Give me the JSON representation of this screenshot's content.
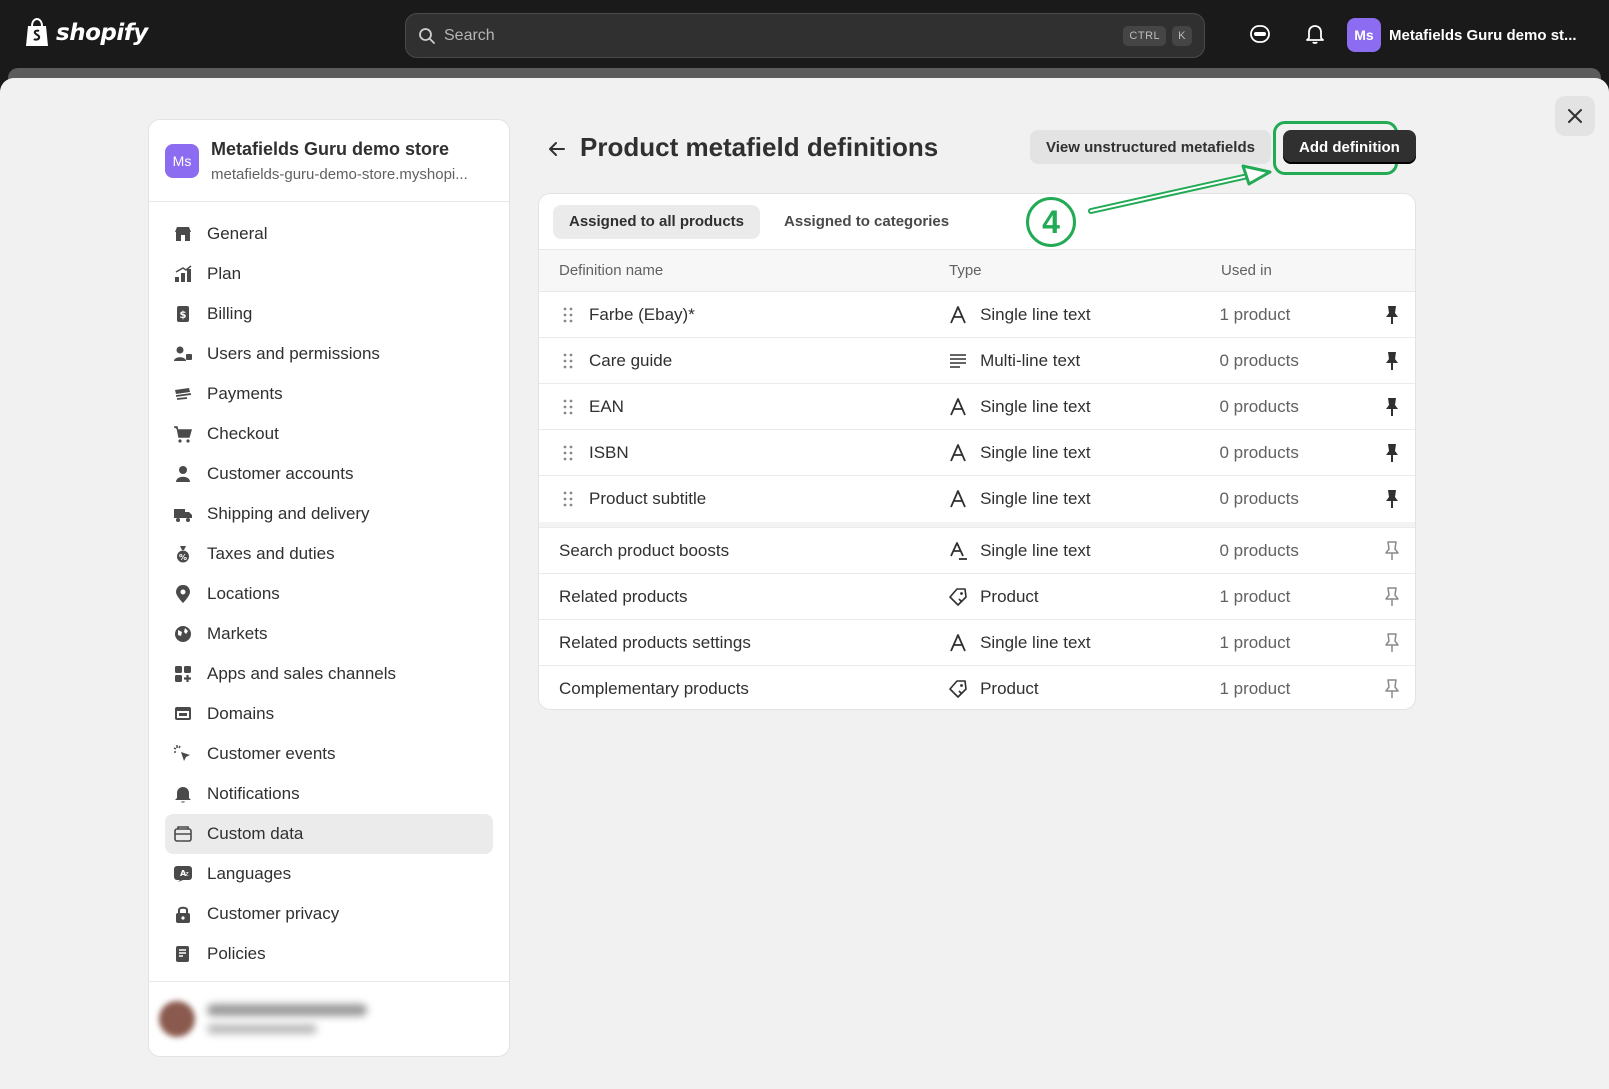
{
  "topbar": {
    "logo_text": "shopify",
    "search_placeholder": "Search",
    "shortcut_keys": [
      "CTRL",
      "K"
    ],
    "store_initials": "Ms",
    "store_name": "Metafields Guru demo st..."
  },
  "sidebar": {
    "store_initials": "Ms",
    "store_name": "Metafields Guru demo store",
    "store_domain": "metafields-guru-demo-store.myshopi...",
    "items": [
      {
        "label": "General",
        "icon": "store-icon"
      },
      {
        "label": "Plan",
        "icon": "plan-icon"
      },
      {
        "label": "Billing",
        "icon": "billing-icon"
      },
      {
        "label": "Users and permissions",
        "icon": "users-icon"
      },
      {
        "label": "Payments",
        "icon": "payments-icon"
      },
      {
        "label": "Checkout",
        "icon": "cart-icon"
      },
      {
        "label": "Customer accounts",
        "icon": "person-icon"
      },
      {
        "label": "Shipping and delivery",
        "icon": "truck-icon"
      },
      {
        "label": "Taxes and duties",
        "icon": "taxes-icon"
      },
      {
        "label": "Locations",
        "icon": "location-icon"
      },
      {
        "label": "Markets",
        "icon": "globe-icon"
      },
      {
        "label": "Apps and sales channels",
        "icon": "apps-icon"
      },
      {
        "label": "Domains",
        "icon": "domains-icon"
      },
      {
        "label": "Customer events",
        "icon": "cursor-icon"
      },
      {
        "label": "Notifications",
        "icon": "bell-icon"
      },
      {
        "label": "Custom data",
        "icon": "custom-data-icon",
        "active": true
      },
      {
        "label": "Languages",
        "icon": "languages-icon"
      },
      {
        "label": "Customer privacy",
        "icon": "lock-icon"
      },
      {
        "label": "Policies",
        "icon": "policies-icon"
      }
    ]
  },
  "main": {
    "title": "Product metafield definitions",
    "view_unstructured_label": "View unstructured metafields",
    "add_definition_label": "Add definition",
    "step_number": "4",
    "tabs": [
      {
        "label": "Assigned to all products",
        "active": true
      },
      {
        "label": "Assigned to categories",
        "active": false
      }
    ],
    "columns": {
      "name": "Definition name",
      "type": "Type",
      "used_in": "Used in"
    },
    "pinned_rows": [
      {
        "name": "Farbe (Ebay)*",
        "type": "Single line text",
        "type_icon": "text-icon",
        "used_in": "1 product"
      },
      {
        "name": "Care guide",
        "type": "Multi-line text",
        "type_icon": "multiline-icon",
        "used_in": "0 products"
      },
      {
        "name": "EAN",
        "type": "Single line text",
        "type_icon": "text-icon",
        "used_in": "0 products"
      },
      {
        "name": "ISBN",
        "type": "Single line text",
        "type_icon": "text-icon",
        "used_in": "0 products"
      },
      {
        "name": "Product subtitle",
        "type": "Single line text",
        "type_icon": "text-icon",
        "used_in": "0 products"
      }
    ],
    "unpinned_rows": [
      {
        "name": "Search product boosts",
        "type": "Single line text",
        "type_icon": "text-list-icon",
        "used_in": "0 products"
      },
      {
        "name": "Related products",
        "type": "Product",
        "type_icon": "product-tag-icon",
        "used_in": "1 product"
      },
      {
        "name": "Related products settings",
        "type": "Single line text",
        "type_icon": "text-icon",
        "used_in": "1 product"
      },
      {
        "name": "Complementary products",
        "type": "Product",
        "type_icon": "product-tag-icon",
        "used_in": "1 product"
      }
    ]
  },
  "colors": {
    "accent_green": "#22aa55",
    "primary_button": "#303030",
    "avatar_purple": "#8c6cf0"
  }
}
